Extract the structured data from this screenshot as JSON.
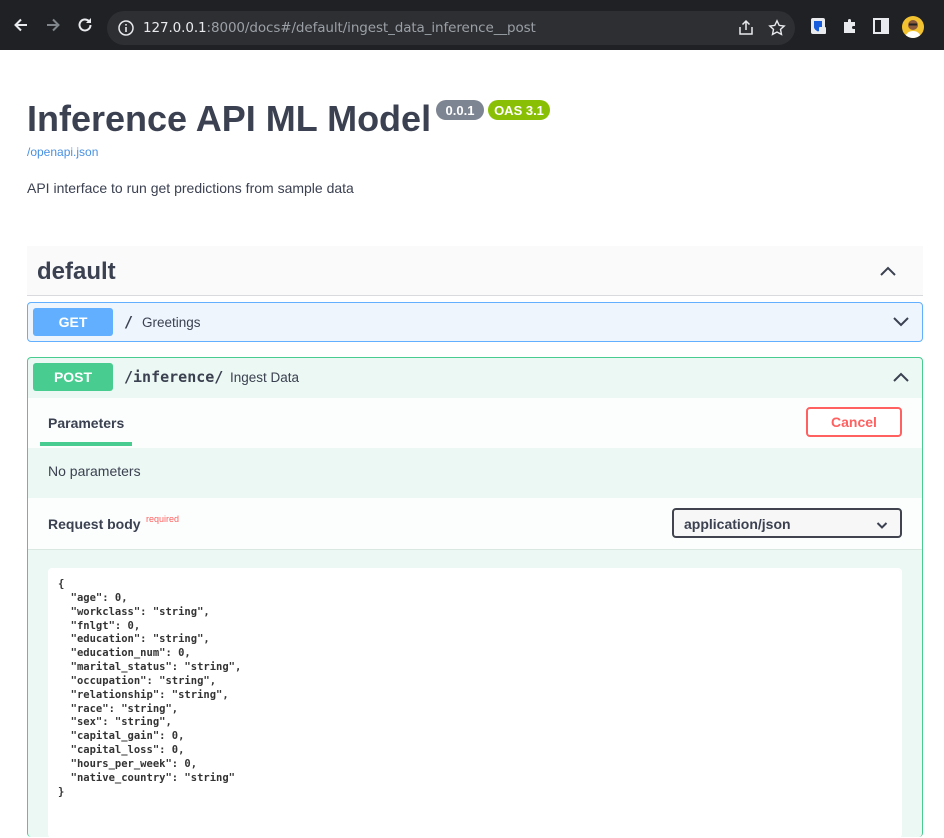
{
  "browser": {
    "url_host": "127.0.0.1",
    "url_rest": ":8000/docs#/default/ingest_data_inference__post"
  },
  "page": {
    "title": "Inference API ML Model",
    "version_badge": "0.0.1",
    "oas_badge": "OAS 3.1",
    "spec_link": "/openapi.json",
    "description": "API interface to run get predictions from sample data"
  },
  "tag": {
    "name": "default"
  },
  "operations": [
    {
      "method": "GET",
      "path": "/",
      "summary": "Greetings"
    },
    {
      "method": "POST",
      "path": "/inference/",
      "summary": "Ingest Data"
    }
  ],
  "post_panel": {
    "params_tab": "Parameters",
    "cancel_label": "Cancel",
    "no_params": "No parameters",
    "request_body_label": "Request body",
    "required_label": "required",
    "content_type": "application/json",
    "body_json": "{\n  \"age\": 0,\n  \"workclass\": \"string\",\n  \"fnlgt\": 0,\n  \"education\": \"string\",\n  \"education_num\": 0,\n  \"marital_status\": \"string\",\n  \"occupation\": \"string\",\n  \"relationship\": \"string\",\n  \"race\": \"string\",\n  \"sex\": \"string\",\n  \"capital_gain\": 0,\n  \"capital_loss\": 0,\n  \"hours_per_week\": 0,\n  \"native_country\": \"string\"\n}"
  },
  "colors": {
    "get": "#61affe",
    "post": "#49cc90",
    "cancel": "#ff6060",
    "oas": "#89bf04"
  }
}
